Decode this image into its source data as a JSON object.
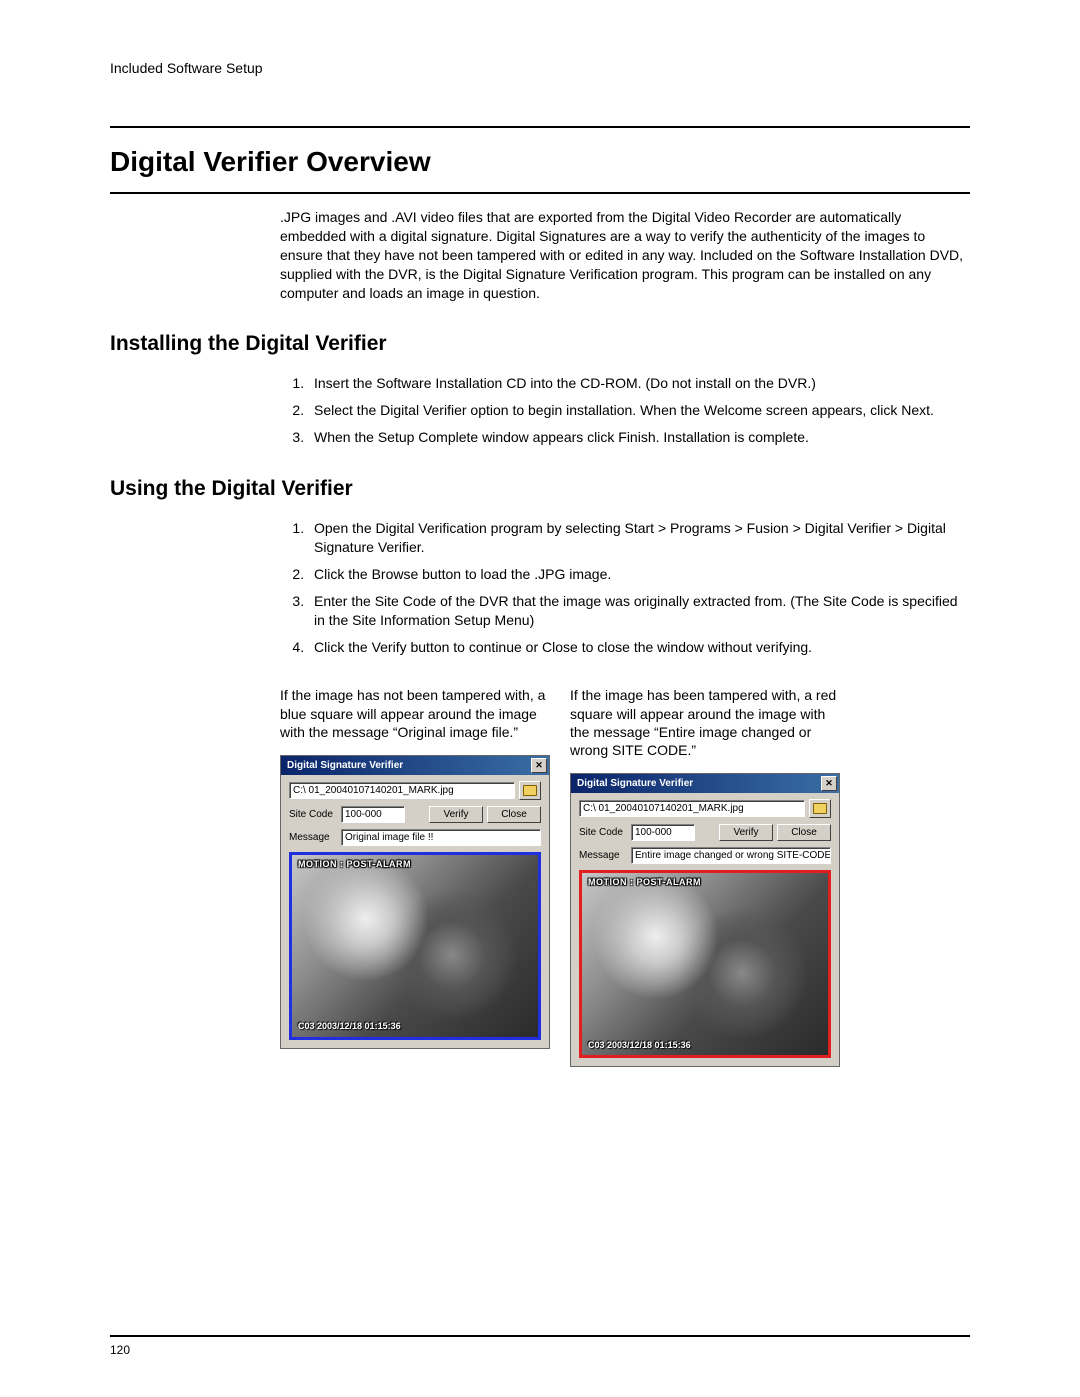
{
  "header": {
    "section_label": "Included Software Setup"
  },
  "headings": {
    "h1": "Digital Verifier Overview",
    "h2a": "Installing the Digital Verifier",
    "h2b": "Using the Digital Verifier"
  },
  "overview_para": ".JPG images and .AVI video files that are exported from the Digital Video Recorder are automatically embedded with a digital signature.  Digital Signatures are a way to verify the authenticity of the images to ensure that they have not been tampered with or edited in any way.  Included on the Software Installation DVD, supplied with the DVR, is the Digital Signature Verification program. This program can be installed on any computer and loads an image in question.",
  "install_steps": [
    "Insert the Software Installation CD into the CD-ROM.  (Do not install on the DVR.)",
    "Select the Digital Verifier option to begin installation.  When the Welcome screen appears, click Next.",
    "When the Setup Complete window appears click Finish.  Installation is complete."
  ],
  "use_steps": [
    "Open the Digital Verification program by selecting Start > Programs > Fusion > Digital Verifier > Digital Signature Verifier.",
    "Click the Browse button to load the .JPG image.",
    "Enter the Site Code of the DVR that the image was originally extracted from.  (The Site Code is specified in the Site Information Setup Menu)",
    "Click the Verify button to continue or Close to close the window without verifying."
  ],
  "columns": {
    "left_caption": "If the image has not been tampered with, a blue square will appear around the image with the message “Original image file.”",
    "right_caption": "If the image has been tampered with, a red square will appear around the image with the message “Entire image changed or wrong SITE CODE.”"
  },
  "verifier": {
    "title": "Digital Signature Verifier",
    "path": "C:\\ 01_20040107140201_MARK.jpg",
    "site_code_label": "Site Code",
    "site_code_value": "100-000",
    "verify_btn": "Verify",
    "close_btn": "Close",
    "message_label": "Message",
    "message_ok": "Original image file !!",
    "message_bad": "Entire image changed or wrong SITE-CODE !!",
    "overlay_top": "MOTION : POST-ALARM",
    "overlay_bottom": "C03 2003/12/18 01:15:36"
  },
  "footer": {
    "page_number": "120"
  }
}
